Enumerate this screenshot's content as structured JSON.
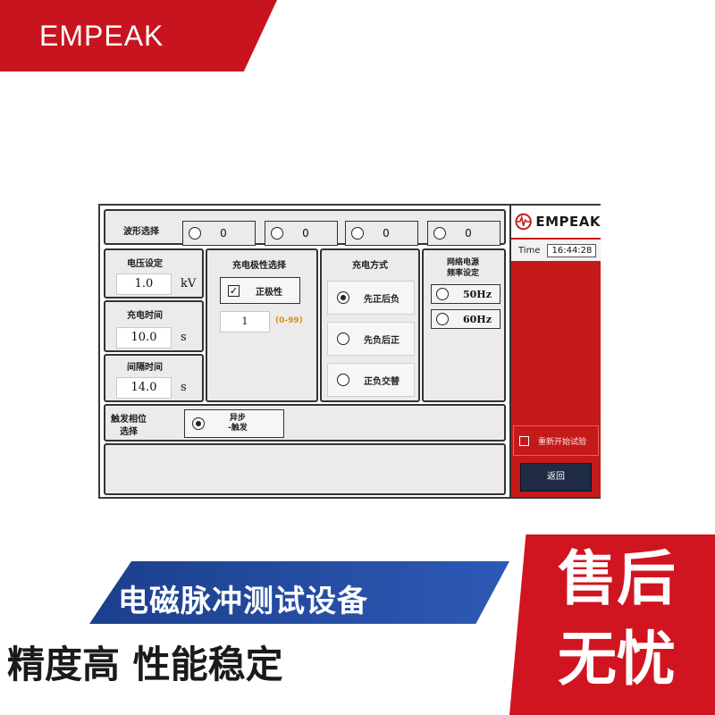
{
  "banner": {
    "brand": "EMPEAK",
    "tagline_blue": "电磁脉冲测试设备",
    "tagline_bottom": "精度高 性能稳定",
    "service_line1": "售后",
    "service_line2": "无忧",
    "colors": {
      "red": "#c8141e",
      "blue": "#1c3f8c"
    }
  },
  "ui": {
    "waveform": {
      "label": "波形选择",
      "options": [
        {
          "value": "0",
          "selected": false
        },
        {
          "value": "0",
          "selected": false
        },
        {
          "value": "0",
          "selected": false
        },
        {
          "value": "0",
          "selected": false
        }
      ]
    },
    "voltage": {
      "label": "电压设定",
      "value": "1.0",
      "unit": "kV"
    },
    "charge_time": {
      "label": "充电时间",
      "value": "10.0",
      "unit": "s"
    },
    "interval_time": {
      "label": "间隔时间",
      "value": "14.0",
      "unit": "s"
    },
    "polarity": {
      "label": "充电极性选择",
      "checkbox_label": "正极性",
      "checked": true,
      "count_value": "1",
      "count_range": "(0-99)"
    },
    "charge_mode": {
      "label": "充电方式",
      "options": [
        {
          "label": "先正后负",
          "selected": true
        },
        {
          "label": "先负后正",
          "selected": false
        },
        {
          "label": "正负交替",
          "selected": false
        }
      ]
    },
    "mains_freq": {
      "label_line1": "网络电源",
      "label_line2": "频率设定",
      "options": [
        {
          "label": "50Hz",
          "selected": false
        },
        {
          "label": "60Hz",
          "selected": false
        }
      ]
    },
    "trigger_phase": {
      "label_line1": "触发相位",
      "label_line2": "选择",
      "option_line1": "异步",
      "option_line2": "-触发",
      "selected": true
    },
    "sidebar": {
      "logo": "EMPEAK",
      "time_label": "Time",
      "time_value": "16:44:28",
      "restart_label": "重新开始试验",
      "back_label": "返回",
      "accent_color": "#c41a1a"
    }
  }
}
